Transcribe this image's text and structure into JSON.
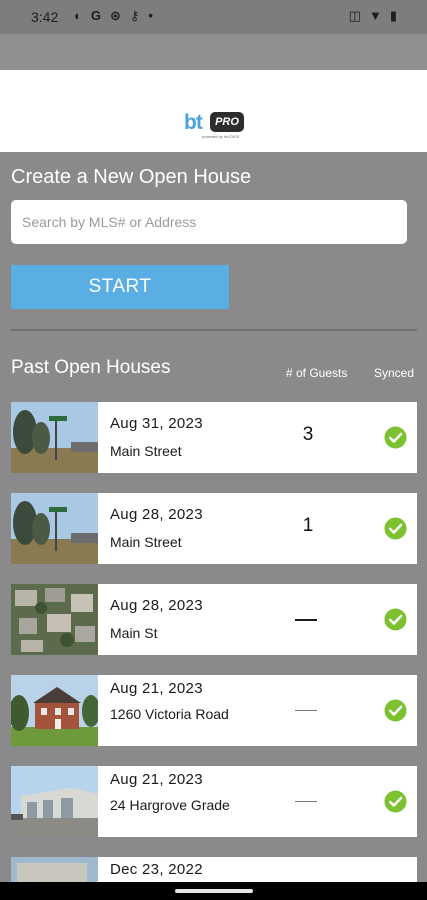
{
  "status_bar": {
    "time": "3:42",
    "left_icons": [
      "app-circle-icon",
      "google-g-icon",
      "app-swirl-icon",
      "key-icon",
      "dot-icon"
    ],
    "left_glyphs": [
      "◐",
      "G",
      "⊛",
      "⚷",
      "•"
    ],
    "right_icons": [
      "vibrate-icon",
      "wifi-icon",
      "battery-icon"
    ],
    "right_glyphs": [
      "◫",
      "▼",
      "▮"
    ]
  },
  "logo": {
    "bt": "bt",
    "pro": "PRO",
    "sub": "powered by InVOICE"
  },
  "create": {
    "title": "Create a New Open House",
    "search_placeholder": "Search by MLS# or Address",
    "search_value": "",
    "start_label": "START"
  },
  "past": {
    "title": "Past Open Houses",
    "col_guests": "# of Guests",
    "col_synced": "Synced",
    "rows": [
      {
        "date": "Aug 31, 2023",
        "address": "Main Street",
        "guests": "3",
        "synced": true,
        "thumb": "street-sign-photo"
      },
      {
        "date": "Aug 28, 2023",
        "address": "Main Street",
        "guests": "1",
        "synced": true,
        "thumb": "street-sign-photo"
      },
      {
        "date": "Aug 28, 2023",
        "address": "Main St",
        "guests": "",
        "synced": true,
        "thumb": "aerial-houses-photo"
      },
      {
        "date": "Aug 21, 2023",
        "address": "1260 Victoria Road",
        "guests": "",
        "synced": true,
        "thumb": "brick-house-photo"
      },
      {
        "date": "Aug 21, 2023",
        "address": "24 Hargrove Grade",
        "guests": "",
        "synced": true,
        "thumb": "warehouse-photo"
      },
      {
        "date": "Dec 23, 2022",
        "address": "",
        "guests": "",
        "synced": true,
        "thumb": "building-photo"
      }
    ]
  },
  "colors": {
    "overlay": "#8a8a8a",
    "accent": "#5aaee3",
    "synced": "#7cc230"
  }
}
